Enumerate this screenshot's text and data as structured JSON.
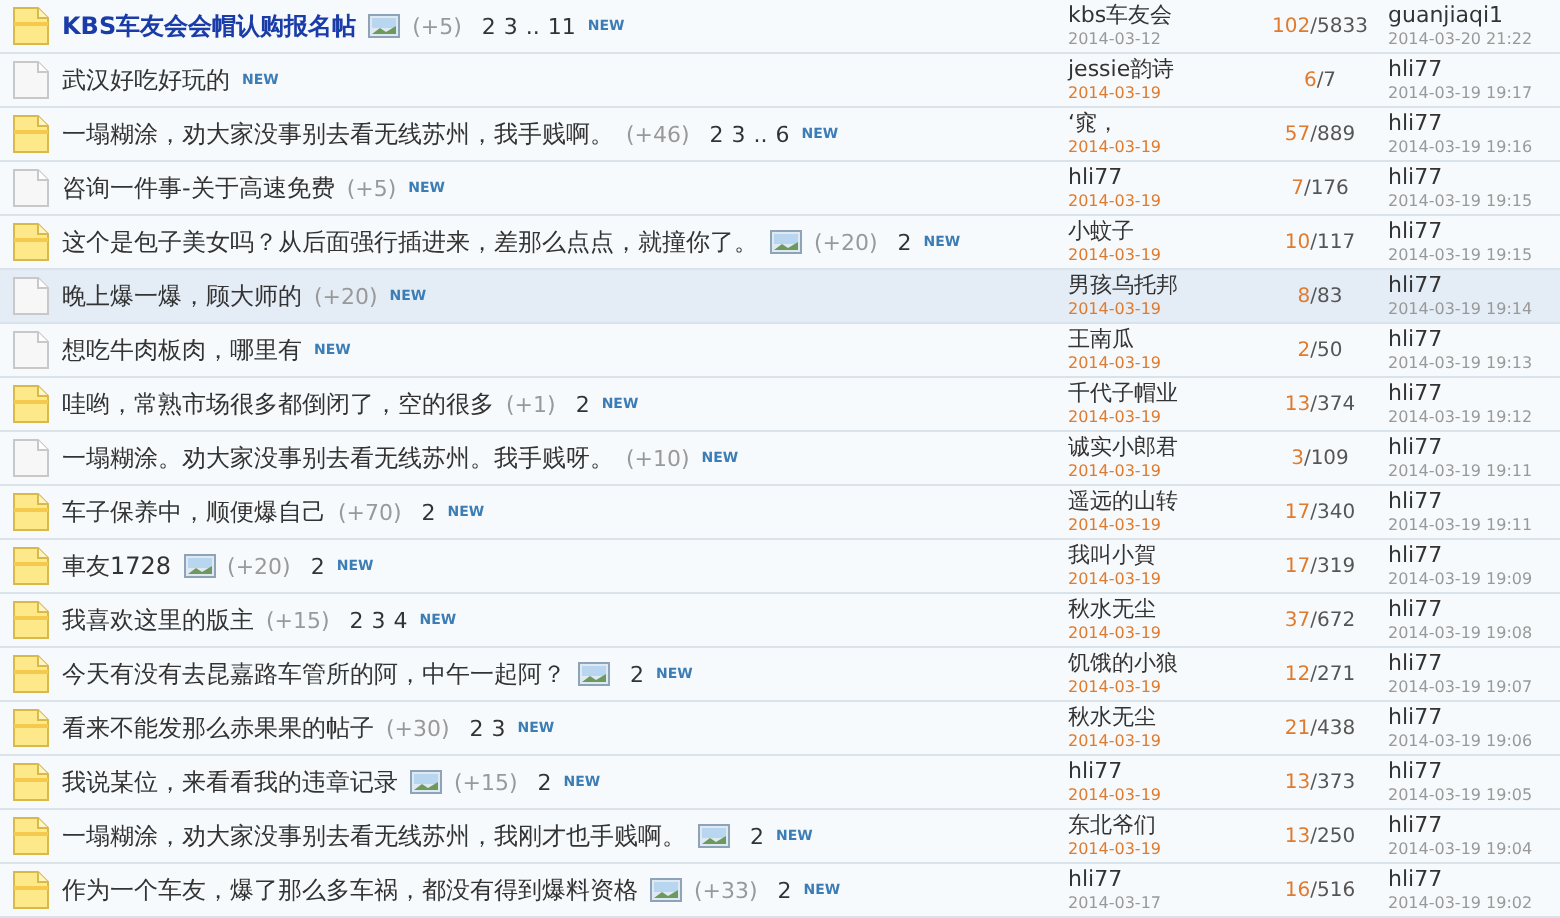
{
  "threads": [
    {
      "kind": "hot",
      "selected": false,
      "bold": true,
      "picture": true,
      "title": "KBS车友会会帽认购报名帖",
      "score": "(+5)",
      "pages": [
        "2",
        "3",
        "..",
        "11"
      ],
      "badge": "NEW",
      "author": "kbs车友会",
      "author_date": "2014-03-12",
      "recent": false,
      "replies": "102",
      "views": "/5833",
      "last_user": "guanjiaqi1",
      "last_time": "2014-03-20 21:22"
    },
    {
      "kind": "normal",
      "selected": false,
      "bold": false,
      "picture": false,
      "title": "武汉好吃好玩的",
      "badge": "NEW",
      "author": "jessie韵诗",
      "author_date": "2014-03-19",
      "recent": true,
      "replies": "6",
      "views": "/7",
      "last_user": "hli77",
      "last_time": "2014-03-19 19:17"
    },
    {
      "kind": "hot",
      "selected": false,
      "bold": false,
      "picture": false,
      "title": "一塌糊涂，劝大家没事别去看无线苏州，我手贱啊。",
      "score": "(+46)",
      "pages": [
        "2",
        "3",
        "..",
        "6"
      ],
      "badge": "NEW",
      "author": "‘窕，",
      "author_date": "2014-03-19",
      "recent": true,
      "replies": "57",
      "views": "/889",
      "last_user": "hli77",
      "last_time": "2014-03-19 19:16"
    },
    {
      "kind": "normal",
      "selected": false,
      "bold": false,
      "picture": false,
      "title": "咨询一件事-关于高速免费",
      "score": "(+5)",
      "badge": "NEW",
      "author": "hli77",
      "author_date": "2014-03-19",
      "recent": true,
      "replies": "7",
      "views": "/176",
      "last_user": "hli77",
      "last_time": "2014-03-19 19:15"
    },
    {
      "kind": "hot",
      "selected": false,
      "bold": false,
      "picture": true,
      "title": "这个是包子美女吗？从后面强行插进来，差那么点点，就撞你了。",
      "score": "(+20)",
      "pages": [
        "2"
      ],
      "badge": "NEW",
      "author": "小蚊子",
      "author_date": "2014-03-19",
      "recent": true,
      "replies": "10",
      "views": "/117",
      "last_user": "hli77",
      "last_time": "2014-03-19 19:15"
    },
    {
      "kind": "normal",
      "selected": true,
      "bold": false,
      "picture": false,
      "title": "晚上爆一爆，顾大师的",
      "score": "(+20)",
      "badge": "NEW",
      "author": "男孩乌托邦",
      "author_date": "2014-03-19",
      "recent": true,
      "replies": "8",
      "views": "/83",
      "last_user": "hli77",
      "last_time": "2014-03-19 19:14"
    },
    {
      "kind": "normal",
      "selected": false,
      "bold": false,
      "picture": false,
      "title": "想吃牛肉板肉，哪里有",
      "badge": "NEW",
      "author": "王南瓜",
      "author_date": "2014-03-19",
      "recent": true,
      "replies": "2",
      "views": "/50",
      "last_user": "hli77",
      "last_time": "2014-03-19 19:13"
    },
    {
      "kind": "hot",
      "selected": false,
      "bold": false,
      "picture": false,
      "title": "哇哟，常熟市场很多都倒闭了，空的很多",
      "score": "(+1)",
      "pages": [
        "2"
      ],
      "badge": "NEW",
      "author": "千代子帽业",
      "author_date": "2014-03-19",
      "recent": true,
      "replies": "13",
      "views": "/374",
      "last_user": "hli77",
      "last_time": "2014-03-19 19:12"
    },
    {
      "kind": "normal",
      "selected": false,
      "bold": false,
      "picture": false,
      "title": "一塌糊涂。劝大家没事别去看无线苏州。我手贱呀。",
      "score": "(+10)",
      "badge": "NEW",
      "author": "诚实小郎君",
      "author_date": "2014-03-19",
      "recent": true,
      "replies": "3",
      "views": "/109",
      "last_user": "hli77",
      "last_time": "2014-03-19 19:11"
    },
    {
      "kind": "hot",
      "selected": false,
      "bold": false,
      "picture": false,
      "title": "车子保养中，顺便爆自己",
      "score": "(+70)",
      "pages": [
        "2"
      ],
      "badge": "NEW",
      "author": "遥远的山转",
      "author_date": "2014-03-19",
      "recent": true,
      "replies": "17",
      "views": "/340",
      "last_user": "hli77",
      "last_time": "2014-03-19 19:11"
    },
    {
      "kind": "hot",
      "selected": false,
      "bold": false,
      "picture": true,
      "title": "車友1728",
      "score": "(+20)",
      "pages": [
        "2"
      ],
      "badge": "NEW",
      "author": "我叫小賀",
      "author_date": "2014-03-19",
      "recent": true,
      "replies": "17",
      "views": "/319",
      "last_user": "hli77",
      "last_time": "2014-03-19 19:09"
    },
    {
      "kind": "hot",
      "selected": false,
      "bold": false,
      "picture": false,
      "title": "我喜欢这里的版主",
      "score": "(+15)",
      "pages": [
        "2",
        "3",
        "4"
      ],
      "badge": "NEW",
      "author": "秋水无尘",
      "author_date": "2014-03-19",
      "recent": true,
      "replies": "37",
      "views": "/672",
      "last_user": "hli77",
      "last_time": "2014-03-19 19:08"
    },
    {
      "kind": "hot",
      "selected": false,
      "bold": false,
      "picture": true,
      "title": "今天有没有去昆嘉路车管所的阿，中午一起阿？",
      "pages": [
        "2"
      ],
      "badge": "NEW",
      "author": "饥饿的小狼",
      "author_date": "2014-03-19",
      "recent": true,
      "replies": "12",
      "views": "/271",
      "last_user": "hli77",
      "last_time": "2014-03-19 19:07"
    },
    {
      "kind": "hot",
      "selected": false,
      "bold": false,
      "picture": false,
      "title": "看来不能发那么赤果果的帖子",
      "score": "(+30)",
      "pages": [
        "2",
        "3"
      ],
      "badge": "NEW",
      "author": "秋水无尘",
      "author_date": "2014-03-19",
      "recent": true,
      "replies": "21",
      "views": "/438",
      "last_user": "hli77",
      "last_time": "2014-03-19 19:06"
    },
    {
      "kind": "hot",
      "selected": false,
      "bold": false,
      "picture": true,
      "title": "我说某位，来看看我的违章记录",
      "score": "(+15)",
      "pages": [
        "2"
      ],
      "badge": "NEW",
      "author": "hli77",
      "author_date": "2014-03-19",
      "recent": true,
      "replies": "13",
      "views": "/373",
      "last_user": "hli77",
      "last_time": "2014-03-19 19:05"
    },
    {
      "kind": "hot",
      "selected": false,
      "bold": false,
      "picture": true,
      "title": "一塌糊涂，劝大家没事别去看无线苏州，我刚才也手贱啊。",
      "pages": [
        "2"
      ],
      "badge": "NEW",
      "author": "东北爷们",
      "author_date": "2014-03-19",
      "recent": true,
      "replies": "13",
      "views": "/250",
      "last_user": "hli77",
      "last_time": "2014-03-19 19:04"
    },
    {
      "kind": "hot",
      "selected": false,
      "bold": false,
      "picture": true,
      "title": "作为一个车友，爆了那么多车祸，都没有得到爆料资格",
      "score": "(+33)",
      "pages": [
        "2"
      ],
      "badge": "NEW",
      "author": "hli77",
      "author_date": "2014-03-17",
      "recent": false,
      "replies": "16",
      "views": "/516",
      "last_user": "hli77",
      "last_time": "2014-03-19 19:02"
    }
  ]
}
